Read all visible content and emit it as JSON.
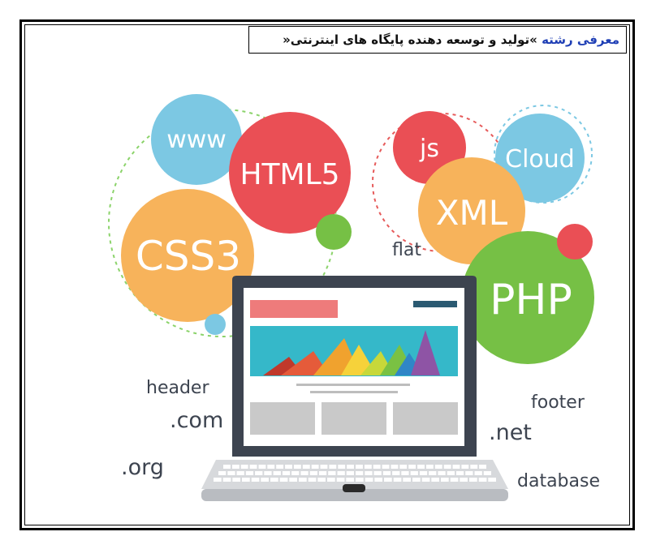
{
  "heading": {
    "accent": "معرفی رشته",
    "rest": " »تولید و توسعه دهنده پایگاه های اینترنتی«"
  },
  "illustration": {
    "bubbles": {
      "www": "www",
      "html5": "HTML5",
      "css3": "CSS3",
      "js": "js",
      "cloud": "Cloud",
      "xml": "XML",
      "php": "PHP"
    },
    "words": {
      "flat": "flat",
      "header": "header",
      "com": ".com",
      "org": ".org",
      "footer": "footer",
      "net": ".net",
      "database": "database"
    },
    "colors": {
      "teal": "#7cc8e3",
      "red": "#ea4f55",
      "orange": "#f7b35b",
      "green": "#76c045",
      "dark": "#3d4450",
      "gray": "#c9c9c9",
      "cyan": "#35b8c9"
    }
  }
}
